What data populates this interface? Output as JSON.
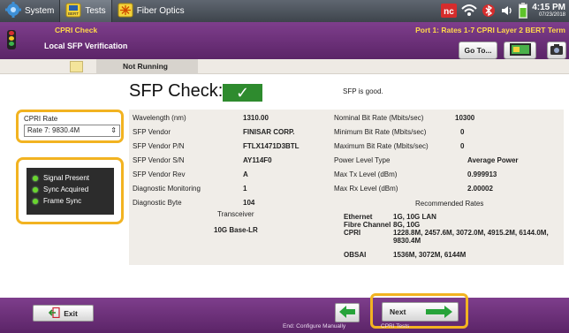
{
  "taskbar": {
    "system_label": "System",
    "tests_label": "Tests",
    "fiber_label": "Fiber Optics",
    "time": "4:15 PM",
    "date": "07/23/2018"
  },
  "header": {
    "crumb": "CPRI Check",
    "title": "Local SFP Verification",
    "port": "Port 1: Rates 1-7 CPRI Layer 2 BERT Term",
    "goto_label": "Go To..."
  },
  "status": {
    "label": "Not Running"
  },
  "main": {
    "title": "SFP Check:",
    "check_mark": "✓",
    "result_msg": "SFP is good."
  },
  "cpri_rate": {
    "label": "CPRI Rate",
    "selected": "Rate 7: 9830.4M"
  },
  "signals": [
    "Signal Present",
    "Sync Acquired",
    "Frame Sync"
  ],
  "left_fields": [
    {
      "key": "Wavelength (nm)",
      "value": "1310.00"
    },
    {
      "key": "SFP Vendor",
      "value": "FINISAR CORP."
    },
    {
      "key": "SFP Vendor P/N",
      "value": "FTLX1471D3BTL"
    },
    {
      "key": "SFP Vendor S/N",
      "value": "AY114F0"
    },
    {
      "key": "SFP Vendor Rev",
      "value": "A"
    },
    {
      "key": "Diagnostic Monitoring",
      "value": "1"
    },
    {
      "key": "Diagnostic Byte",
      "value": "104"
    }
  ],
  "transceiver": {
    "label": "Transceiver",
    "value": "10G Base-LR"
  },
  "right_fields": [
    {
      "key": "Nominal Bit Rate (Mbits/sec)",
      "value": "10300"
    },
    {
      "key": "Minimum Bit Rate (Mbits/sec)",
      "value": "0"
    },
    {
      "key": "Maximum Bit Rate (Mbits/sec)",
      "value": "0"
    },
    {
      "key": "Power Level Type",
      "value": "Average Power"
    },
    {
      "key": "Max Tx Level (dBm)",
      "value": "0.999913"
    },
    {
      "key": "Max Rx Level (dBm)",
      "value": "2.00002"
    }
  ],
  "recommended": {
    "title": "Recommended Rates",
    "rows": [
      {
        "key": "Ethernet",
        "value": "1G, 10G LAN"
      },
      {
        "key": "Fibre Channel",
        "value": "8G, 10G"
      },
      {
        "key": "CPRI",
        "value": "1228.8M, 2457.6M, 3072.0M, 4915.2M, 6144.0M, 9830.4M"
      },
      {
        "key": "OBSAI",
        "value": "1536M, 3072M, 6144M"
      }
    ]
  },
  "footer": {
    "exit_label": "Exit",
    "end_label": "End: Configure Manually",
    "next_label": "Next",
    "next_sub": "CPRI Tests"
  },
  "colors": {
    "header_purple": "#6b2f78",
    "highlight": "#f2b321",
    "ok_green": "#2e8b2e",
    "led_green": "#6ad62d"
  }
}
